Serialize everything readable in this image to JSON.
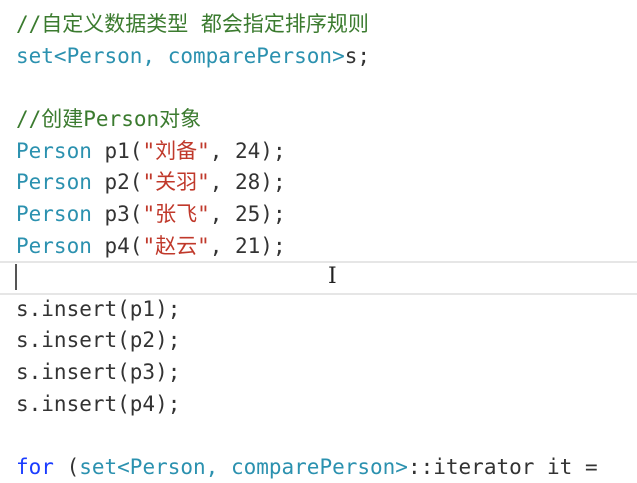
{
  "editor": {
    "lines": [
      [
        {
          "t": "//自定义数据类型 都会指定排序规则",
          "k": "comment"
        }
      ],
      [
        {
          "t": "set<Person, comparePerson>",
          "k": "type"
        },
        {
          "t": "s;",
          "k": "plain"
        }
      ],
      [],
      [
        {
          "t": "//创建Person对象",
          "k": "comment"
        }
      ],
      [
        {
          "t": "Person",
          "k": "type"
        },
        {
          "t": " p1(",
          "k": "plain"
        },
        {
          "t": "\"刘备\"",
          "k": "string"
        },
        {
          "t": ", 24);",
          "k": "plain"
        }
      ],
      [
        {
          "t": "Person",
          "k": "type"
        },
        {
          "t": " p2(",
          "k": "plain"
        },
        {
          "t": "\"关羽\"",
          "k": "string"
        },
        {
          "t": ", 28);",
          "k": "plain"
        }
      ],
      [
        {
          "t": "Person",
          "k": "type"
        },
        {
          "t": " p3(",
          "k": "plain"
        },
        {
          "t": "\"张飞\"",
          "k": "string"
        },
        {
          "t": ", 25);",
          "k": "plain"
        }
      ],
      [
        {
          "t": "Person",
          "k": "type"
        },
        {
          "t": " p4(",
          "k": "plain"
        },
        {
          "t": "\"赵云\"",
          "k": "string"
        },
        {
          "t": ", 21);",
          "k": "plain"
        }
      ],
      [],
      [
        {
          "t": "s.insert(p1);",
          "k": "plain"
        }
      ],
      [
        {
          "t": "s.insert(p2);",
          "k": "plain"
        }
      ],
      [
        {
          "t": "s.insert(p3);",
          "k": "plain"
        }
      ],
      [
        {
          "t": "s.insert(p4);",
          "k": "plain"
        }
      ],
      [],
      [
        {
          "t": "for",
          "k": "keyword"
        },
        {
          "t": " (",
          "k": "plain"
        },
        {
          "t": "set<Person, comparePerson>",
          "k": "type"
        },
        {
          "t": "::iterator it =",
          "k": "plain"
        }
      ]
    ],
    "ibeam_glyph": "I"
  }
}
